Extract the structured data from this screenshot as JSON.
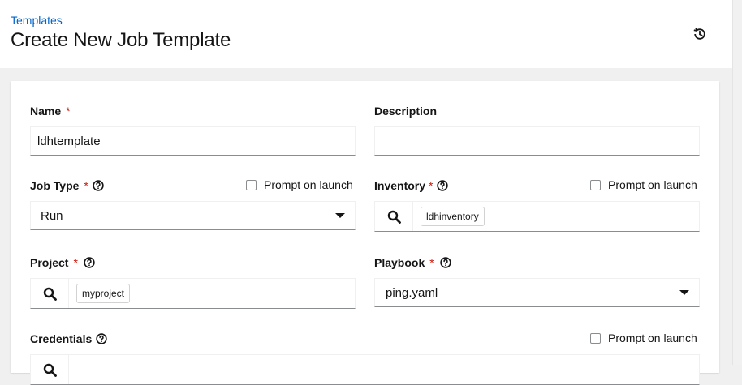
{
  "header": {
    "breadcrumb": "Templates",
    "title": "Create New Job Template"
  },
  "form": {
    "required_marker": "*",
    "prompt_on_launch": "Prompt on launch",
    "name": {
      "label": "Name",
      "value": "ldhtemplate"
    },
    "description": {
      "label": "Description",
      "value": ""
    },
    "job_type": {
      "label": "Job Type",
      "value": "Run"
    },
    "inventory": {
      "label": "Inventory",
      "value": "ldhinventory"
    },
    "project": {
      "label": "Project",
      "value": "myproject"
    },
    "playbook": {
      "label": "Playbook",
      "value": "ping.yaml"
    },
    "credentials": {
      "label": "Credentials"
    }
  },
  "colors": {
    "link": "#0066cc",
    "required": "#c9190b",
    "text": "#151515",
    "page_bg": "#f0f0f0"
  },
  "icons": [
    "history-icon",
    "help-icon",
    "search-icon",
    "caret-down-icon"
  ]
}
